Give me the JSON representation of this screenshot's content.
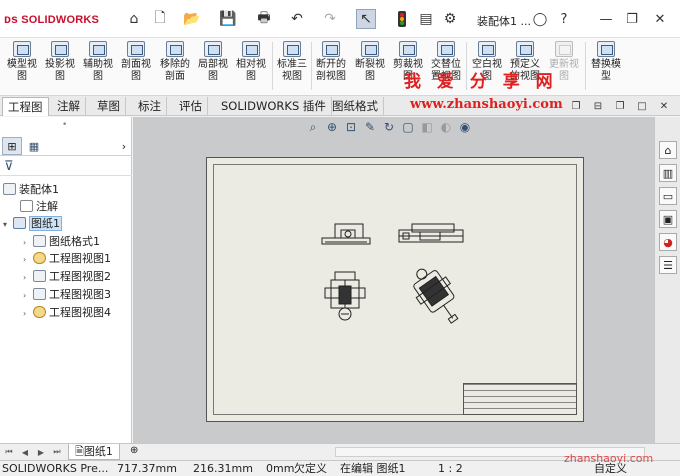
{
  "app": {
    "name": "SOLIDWORKS",
    "doc_title": "装配体1 ..."
  },
  "ribbon": {
    "buttons": [
      {
        "label": "模型视图",
        "enabled": true
      },
      {
        "label": "投影视图",
        "enabled": true
      },
      {
        "label": "辅助视图",
        "enabled": true
      },
      {
        "label": "剖面视图",
        "enabled": true
      },
      {
        "label": "移除的剖面",
        "enabled": true
      },
      {
        "label": "局部视图",
        "enabled": true
      },
      {
        "label": "相对视图",
        "enabled": true
      },
      {
        "label": "标准三视图",
        "enabled": true
      },
      {
        "label": "断开的剖视图",
        "enabled": true
      },
      {
        "label": "断裂视图",
        "enabled": true
      },
      {
        "label": "剪裁视图",
        "enabled": true
      },
      {
        "label": "交替位置视图",
        "enabled": true
      },
      {
        "label": "空白视图",
        "enabled": true
      },
      {
        "label": "预定义的视图",
        "enabled": true
      },
      {
        "label": "更新视图",
        "enabled": false
      },
      {
        "label": "替换模型",
        "enabled": true
      }
    ]
  },
  "watermark": {
    "cn": "我 爱 分 享 网",
    "url": "www.zhanshaoyi.com",
    "bottom": "zhanshaoyi.com"
  },
  "tabs": [
    "工程图",
    "注解",
    "草图",
    "标注",
    "评估",
    "SOLIDWORKS 插件",
    "图纸格式"
  ],
  "active_tab": "工程图",
  "feature_tree": {
    "root": "装配体1",
    "items": [
      {
        "label": "注解",
        "level": 1,
        "expander": ""
      },
      {
        "label": "图纸1",
        "level": 0,
        "expander": "▾",
        "selected": true
      },
      {
        "label": "图纸格式1",
        "level": 1,
        "expander": "›"
      },
      {
        "label": "工程图视图1",
        "level": 1,
        "expander": "›"
      },
      {
        "label": "工程图视图2",
        "level": 1,
        "expander": "›"
      },
      {
        "label": "工程图视图3",
        "level": 1,
        "expander": "›"
      },
      {
        "label": "工程图视图4",
        "level": 1,
        "expander": "›"
      }
    ]
  },
  "sheet_tab": "图纸1",
  "status": {
    "product": "SOLIDWORKS Pre...",
    "x": "717.37mm",
    "y": "216.31mm",
    "z": "0mm",
    "definition": "欠定义",
    "editing": "在编辑 图纸1",
    "scale": "1 : 2",
    "units": "自定义"
  },
  "icons": {
    "home": "home-icon",
    "new": "new-doc-icon",
    "open": "open-icon",
    "save": "save-icon",
    "print": "print-icon",
    "undo": "undo-icon",
    "redo": "redo-icon",
    "select": "select-arrow-icon",
    "rebuild": "traffic-light-icon",
    "options": "gear-icon"
  },
  "colors": {
    "brand_red": "#c8102e",
    "sheet_bg": "#ecebe3",
    "canvas_bg": "#c9cacc",
    "watermark": "#e02020"
  }
}
